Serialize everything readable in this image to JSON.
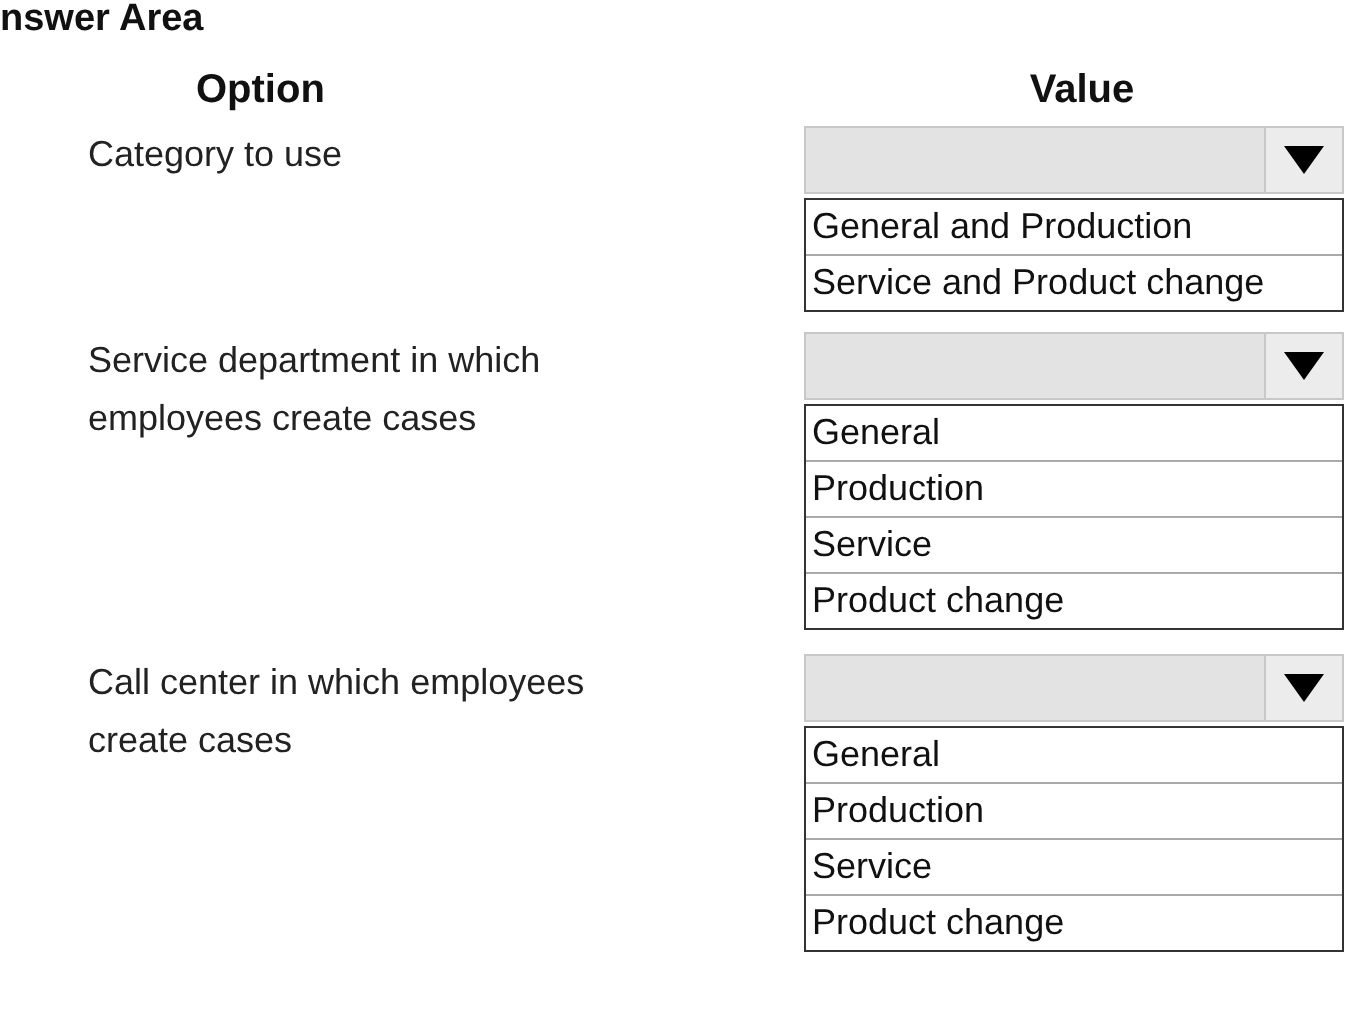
{
  "heading": "nswer Area",
  "columns": [
    "Option",
    "Value"
  ],
  "rows": [
    {
      "label": "Category to use",
      "options": [
        "General and Production",
        "Service and Product change"
      ]
    },
    {
      "label": "Service department in which employees create cases",
      "options": [
        "General",
        "Production",
        "Service",
        "Product change"
      ]
    },
    {
      "label": "Call center in which employees create cases",
      "options": [
        "General",
        "Production",
        "Service",
        "Product change"
      ]
    }
  ]
}
